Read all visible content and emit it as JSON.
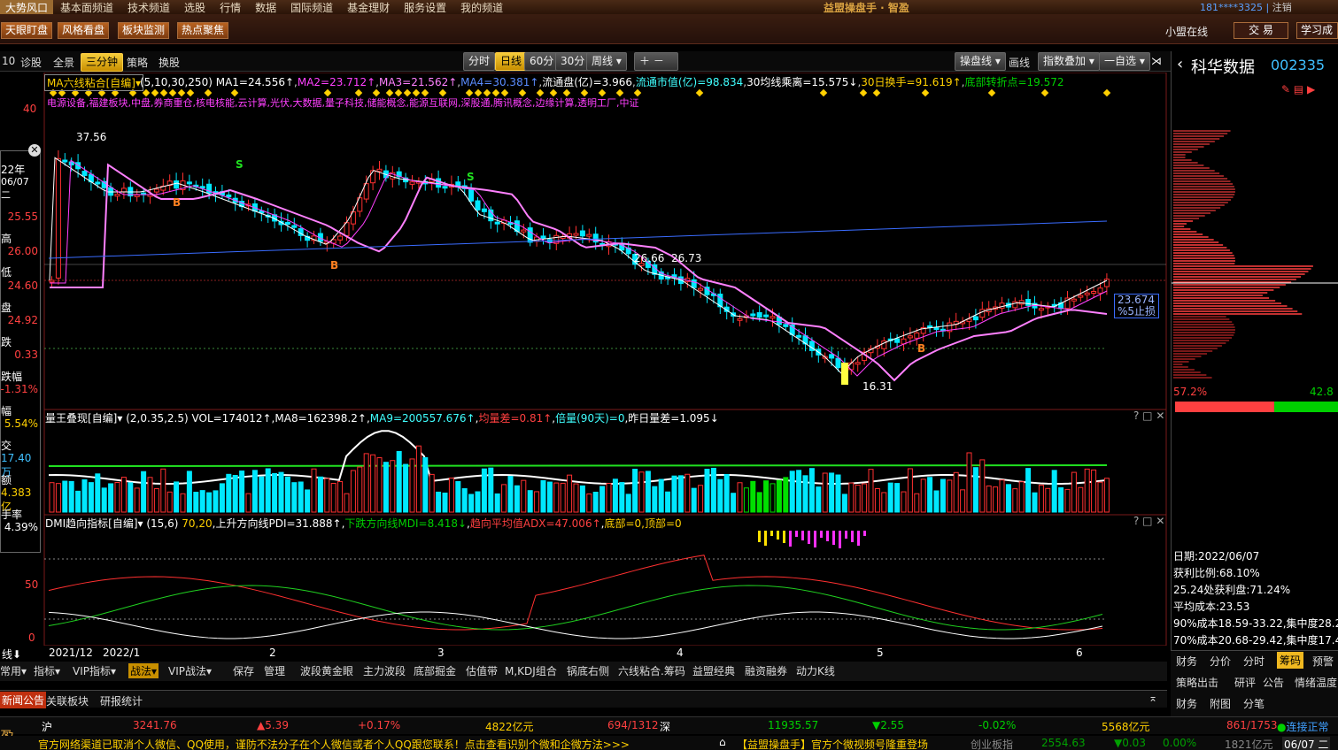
{
  "menu": {
    "items": [
      "大势风口",
      "基本面频道",
      "技术频道",
      "选股",
      "行情",
      "数据",
      "国际频道",
      "基金理财",
      "服务设置",
      "我的频道"
    ],
    "app_title": "益盟操盘手 · 智盈",
    "user": "181****3325",
    "logout": "注销"
  },
  "toolbar": {
    "buttons": [
      "天眼盯盘",
      "风格看盘",
      "板块监测",
      "热点聚焦"
    ],
    "online": "小盟在线",
    "trade": "交 易",
    "learn": "学习成"
  },
  "period_bar": {
    "left": [
      "10",
      "诊股",
      "全景",
      "三分钟",
      "策略",
      "换股"
    ],
    "periods": [
      "分时",
      "日线",
      "60分",
      "30分",
      "周线"
    ],
    "active_period": "日线",
    "right": [
      "操盘线",
      "画线",
      "指数叠加",
      "一自选"
    ]
  },
  "stock": {
    "name": "科华数据",
    "code": "002335"
  },
  "main_indicator": {
    "name": "MA六线粘合[自编]",
    "params": "(5,10,30,250)",
    "ma1": "MA1=24.556↑",
    "ma2": "MA2=23.712↑",
    "ma3": "MA3=21.562↑",
    "ma4": "MA4=30.381↑",
    "float_shares": "流通盘(亿)=3.966",
    "float_cap": "流通市值(亿)=98.834",
    "ma30_dev": "30均线乘离=15.575↓",
    "turnover30": "30日换手=91.619↑",
    "bottom_turn": "底部转折点=19.572",
    "concepts": "电源设备,福建板块,中盘,券商重仓,核电核能,云计算,光伏,大数据,量子科技,储能概念,能源互联网,深股通,腾讯概念,边缘计算,透明工厂,中证",
    "price_labels": [
      "37.56",
      "26.66",
      "26.73",
      "16.31"
    ],
    "stop_price": "23.674",
    "stop_label": "%5止损",
    "y_ticks": [
      "40"
    ]
  },
  "volume_indicator": {
    "name": "量王叠现[自编]",
    "params": "(2,0.35,2.5)",
    "vol": "VOL=174012↑",
    "ma8": "MA8=162398.2↑",
    "ma9": "MA9=200557.676↑",
    "avg_diff": "均量差=0.81↑",
    "ratio": "倍量(90天)=0",
    "yest_ratio": "昨日量差=1.095↓"
  },
  "dmi_indicator": {
    "name": "DMI趋向指标[自编]",
    "params": "(15,6)",
    "levels": "70,20",
    "pdi": "上升方向线PDI=31.888↑",
    "mdi": "下跌方向线MDI=8.418↓",
    "adx": "趋向平均值ADX=47.006↑",
    "bottom": "底部=0,顶部=0",
    "y_ticks": [
      "50",
      "0"
    ]
  },
  "x_axis": [
    "2021/12",
    "2022/1",
    "2",
    "3",
    "4",
    "5",
    "6"
  ],
  "info_panel": {
    "year": "22年",
    "date": "06/07 二",
    "rows": [
      {
        "label": "",
        "value": "25.55"
      },
      {
        "label": "高",
        "value": "26.00"
      },
      {
        "label": "低",
        "value": "24.60"
      },
      {
        "label": "盘",
        "value": "24.92"
      },
      {
        "label": "跌",
        "value": "0.33"
      },
      {
        "label": "跌幅",
        "value": "-1.31%"
      },
      {
        "label": "幅",
        "value": "5.54%"
      },
      {
        "label": "交",
        "value": "17.40万"
      },
      {
        "label": "额",
        "value": "4.383亿"
      },
      {
        "label": "手率",
        "value": "4.39%"
      }
    ]
  },
  "chip_panel": {
    "left_pct": "57.2%",
    "right_pct": "42.8",
    "date": "日期:2022/06/07",
    "profit_ratio": "获利比例:68.10%",
    "profit_at": "25.24处获利盘:71.24%",
    "avg_cost": "平均成本:23.53",
    "c90": "90%成本18.59-33.22,集中度28.2",
    "c70": "70%成本20.68-29.42,集中度17.4",
    "tabs1": [
      "财务",
      "分价",
      "分时",
      "筹码",
      "预警"
    ],
    "active_tab": "筹码",
    "tabs2": [
      "策略出击",
      "研评",
      "公告",
      "情绪温度"
    ],
    "tabs3": [
      "财务",
      "附图",
      "分笔"
    ]
  },
  "bottom_toolbar": {
    "items": [
      "常用",
      "指标",
      "VIP指标",
      "战法",
      "VIP战法",
      "保存",
      "管理",
      "波段黄金眼",
      "主力波段",
      "底部掘金",
      "估值带",
      "M,KDJ组合",
      "锅底右侧",
      "六线粘合.筹码",
      "益盟经典",
      "融资融券",
      "动力K线"
    ]
  },
  "news_tabs": [
    "新闻公告",
    "关联板块",
    "研报统计"
  ],
  "ticker": {
    "sh_label": "沪",
    "sh_index": "3241.76",
    "sh_change": "▲5.39",
    "sh_pct": "+0.17%",
    "sh_amount": "4822亿元",
    "sh_updown": "694/1312",
    "sz_label": "深",
    "sz_index": "11935.57",
    "sz_change": "▼2.55",
    "sz_pct": "-0.02%",
    "sz_amount": "5568亿元",
    "sz_updown": "861/1753",
    "status": "连接正常"
  },
  "scroll": {
    "msg1": "官方网络渠道已取消个人微信、QQ使用，谨防不法分子在个人微信或者个人QQ跟您联系！点击查看识别个微和企微方法>>>",
    "msg2": "【益盟操盘手】官方个微视频号隆重登场",
    "board": "创业板指",
    "board_val": "2554.63",
    "board_chg": "▼0.03",
    "board_pct": "0.00%",
    "board_amt": "1821亿元",
    "date": "06/07 二",
    "logo": "盈"
  },
  "colors": {
    "up": "#ff3030",
    "down": "#00ffff",
    "ma1": "#ffffff",
    "ma2": "#ff40ff",
    "ma3": "#ff80ff",
    "ma4": "#3a6cff"
  }
}
